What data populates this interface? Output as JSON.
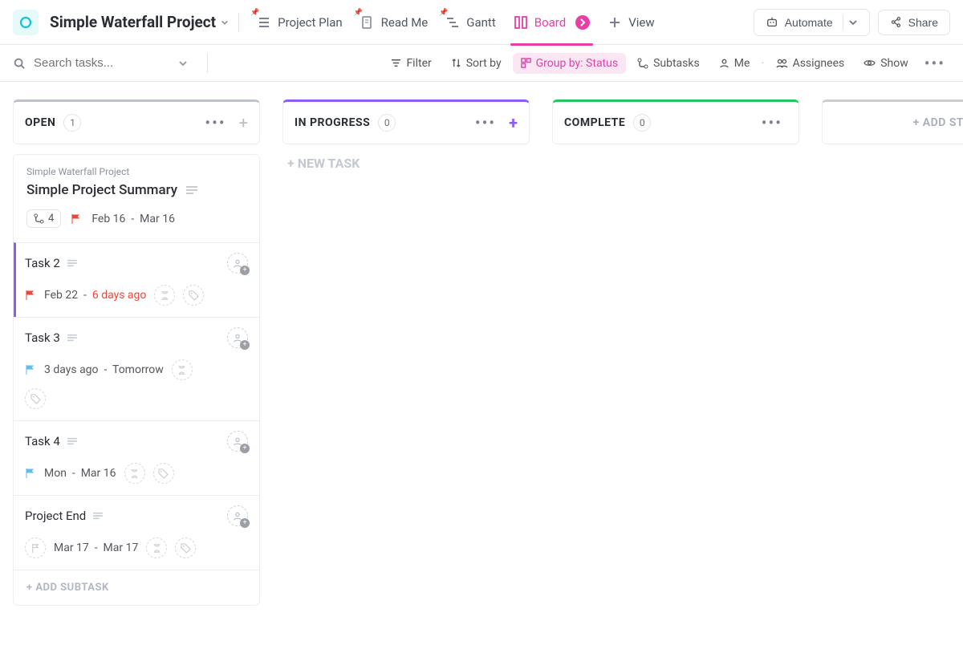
{
  "header": {
    "project_title": "Simple Waterfall Project",
    "tabs": {
      "plan": "Project Plan",
      "readme": "Read Me",
      "gantt": "Gantt",
      "board": "Board",
      "addview": "View"
    },
    "automate": "Automate",
    "share": "Share"
  },
  "toolbar": {
    "search_placeholder": "Search tasks...",
    "filter": "Filter",
    "sort": "Sort by",
    "group": "Group by: Status",
    "subtasks": "Subtasks",
    "me": "Me",
    "assignees": "Assignees",
    "show": "Show"
  },
  "columns": {
    "open": {
      "name": "OPEN",
      "count": "1"
    },
    "in_progress": {
      "name": "IN PROGRESS",
      "count": "0",
      "newtask": "+ NEW TASK"
    },
    "complete": {
      "name": "COMPLETE",
      "count": "0"
    },
    "add_status": {
      "name": "+ ADD STAT"
    }
  },
  "card": {
    "crumb": "Simple Waterfall Project",
    "title": "Simple Project Summary",
    "subcount": "4",
    "date_start": "Feb 16",
    "date_end": "Mar 16",
    "add_subtask": "+ ADD SUBTASK"
  },
  "subtasks": [
    {
      "name": "Task 2",
      "flag": "red",
      "date1": "Feb 22",
      "date2": "6 days ago",
      "overdue": true,
      "hover": true,
      "show_tag_row2": false
    },
    {
      "name": "Task 3",
      "flag": "blue",
      "date1": "3 days ago",
      "date2": "Tomorrow",
      "overdue": false,
      "hover": false,
      "show_tag_row2": true
    },
    {
      "name": "Task 4",
      "flag": "blue",
      "date1": "Mon",
      "date2": "Mar 16",
      "overdue": false,
      "hover": false,
      "show_tag_row2": false
    },
    {
      "name": "Project End",
      "flag": "none",
      "date1": "Mar 17",
      "date2": "Mar 17",
      "overdue": false,
      "hover": false,
      "show_tag_row2": false
    }
  ]
}
